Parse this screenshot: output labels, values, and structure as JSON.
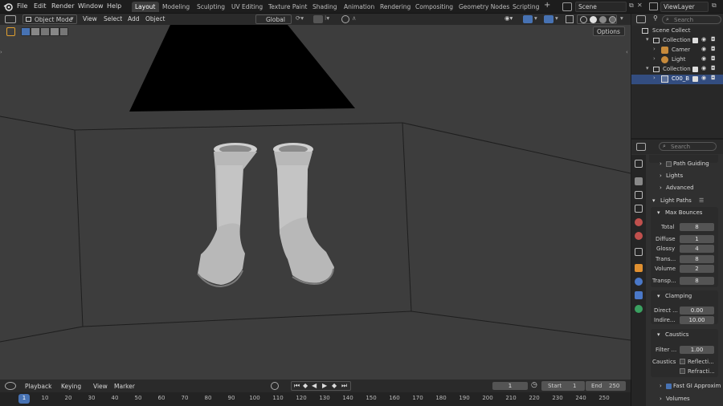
{
  "menu": {
    "items": [
      "File",
      "Edit",
      "Render",
      "Window",
      "Help"
    ],
    "workspaces": [
      "Layout",
      "Modeling",
      "Sculpting",
      "UV Editing",
      "Texture Paint",
      "Shading",
      "Animation",
      "Rendering",
      "Compositing",
      "Geometry Nodes",
      "Scripting"
    ],
    "active_workspace": "Layout",
    "add_tab": "+",
    "scene": "Scene",
    "view_layer": "ViewLayer"
  },
  "viewport_header": {
    "mode": "Object Mode",
    "menus": [
      "View",
      "Select",
      "Add",
      "Object"
    ],
    "orientation": "Global",
    "options": "Options"
  },
  "outliner": {
    "search_placeholder": "Search",
    "rows": [
      "Scene Collect",
      "Collection",
      "Camer",
      "Light",
      "Collection",
      "C00_B"
    ]
  },
  "properties": {
    "search_placeholder": "Search",
    "sections": {
      "path_guiding": "Path Guiding",
      "lights": "Lights",
      "advanced": "Advanced",
      "light_paths": "Light Paths",
      "max_bounces": "Max Bounces",
      "clamping": "Clamping",
      "caustics": "Caustics",
      "fast_gi": "Fast GI Approxim",
      "volumes": "Volumes"
    },
    "fields": {
      "total_label": "Total",
      "total": "8",
      "diffuse_label": "Diffuse",
      "diffuse": "1",
      "glossy_label": "Glossy",
      "glossy": "4",
      "trans_label": "Trans...",
      "trans": "8",
      "volume_label": "Volume",
      "volume": "2",
      "transp_label": "Transp...",
      "transp": "8",
      "direct_label": "Direct ...",
      "direct": "0.00",
      "indirect_label": "Indire...",
      "indirect": "10.00",
      "filter_label": "Filter ...",
      "filter": "1.00",
      "caustics_label": "Caustics",
      "reflective": "Reflecti...",
      "refractive": "Refracti..."
    }
  },
  "timeline": {
    "menus": [
      "Playback",
      "Keying",
      "View",
      "Marker"
    ],
    "current_frame": "1",
    "start_label": "Start",
    "start": "1",
    "end_label": "End",
    "end": "250",
    "ruler": [
      "1",
      "10",
      "20",
      "30",
      "40",
      "50",
      "60",
      "70",
      "80",
      "90",
      "100",
      "110",
      "120",
      "130",
      "140",
      "150",
      "160",
      "170",
      "180",
      "190",
      "200",
      "210",
      "220",
      "230",
      "240",
      "250"
    ]
  },
  "colors": {
    "accent": "#4772b3",
    "selected_row": "#334d80",
    "viewport_bg": "#3d3d3d"
  }
}
